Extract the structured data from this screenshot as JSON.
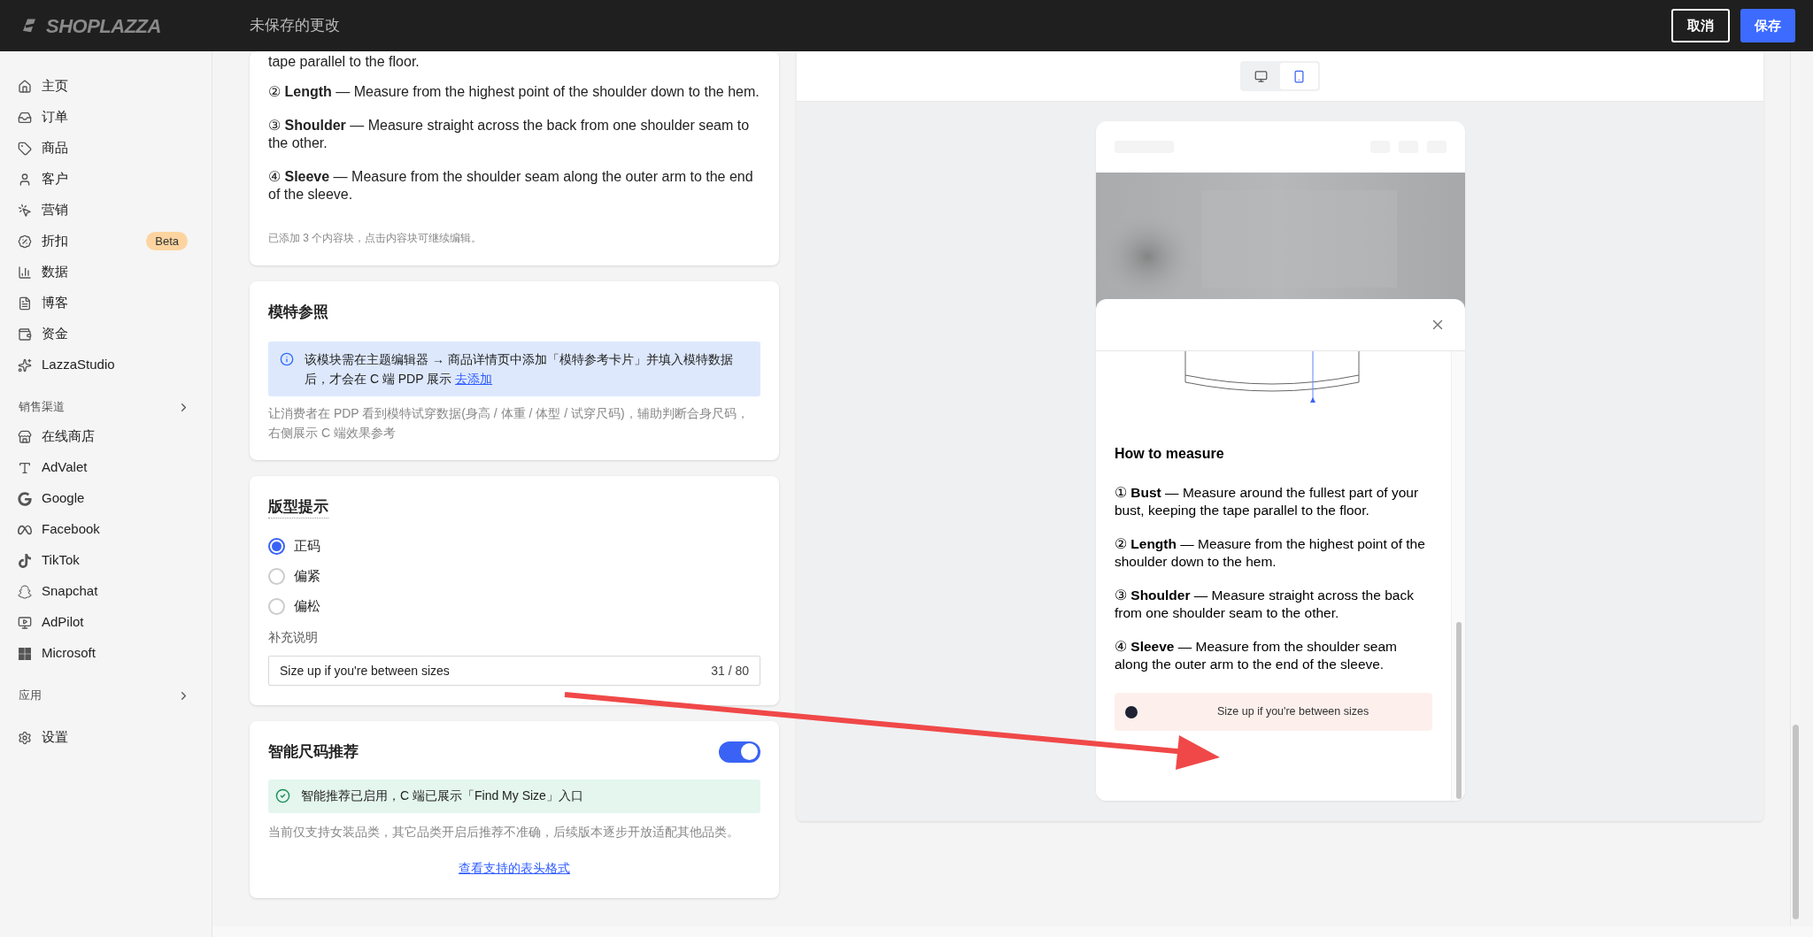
{
  "header": {
    "logo": "SHOPLAZZA",
    "title": "未保存的更改",
    "buttons": [
      {
        "label": "取消",
        "kind": "secondary"
      },
      {
        "label": "保存",
        "kind": "primary"
      }
    ]
  },
  "sidebar": {
    "groups": [
      {
        "items": [
          {
            "label": "主页"
          },
          {
            "label": "订单"
          },
          {
            "label": "商品"
          },
          {
            "label": "客户"
          },
          {
            "label": "营销"
          },
          {
            "label": "折扣",
            "badge": "Beta"
          },
          {
            "label": "数据"
          },
          {
            "label": "博客"
          },
          {
            "label": "资金"
          },
          {
            "label": "LazzaStudio"
          }
        ]
      },
      {
        "heading": "销售渠道",
        "items": [
          {
            "label": "在线商店"
          },
          {
            "label": "AdValet"
          },
          {
            "label": "Google"
          },
          {
            "label": "Facebook"
          },
          {
            "label": "TikTok"
          },
          {
            "label": "Snapchat"
          },
          {
            "label": "AdPilot"
          },
          {
            "label": "Microsoft"
          }
        ]
      },
      {
        "heading": "应用"
      },
      {
        "items": [
          {
            "label": "设置"
          }
        ]
      }
    ]
  },
  "editor": {
    "measure_card": {
      "partial_line": "tape parallel to the floor.",
      "steps": [
        "② **Length** — Measure from the highest point of the shoulder down to the hem.",
        "③ **Shoulder** — Measure straight across the back from one shoulder seam to the other.",
        "④ **Sleeve** — Measure from the shoulder seam along the outer arm to the end of the sleeve."
      ],
      "note": "已添加 3 个内容块，点击内容块可继续编辑。"
    },
    "model_card": {
      "title": "模特参照",
      "info": "该模块需在主题编辑器 → 商品详情页中添加「模特参考卡片」并填入模特数据后，才会在 C 端 PDP 展示",
      "info_link": "去添加",
      "description": "让消费者在 PDP 看到模特试穿数据(身高 / 体重 / 体型 / 试穿尺码)，辅助判断合身尺码，右侧展示 C 端效果参考"
    },
    "fit_card": {
      "title": "版型提示",
      "options": [
        {
          "label": "正码",
          "selected": true
        },
        {
          "label": "偏紧",
          "selected": false
        },
        {
          "label": "偏松",
          "selected": false
        }
      ],
      "field_label": "补充说明",
      "field_value": "Size up if you're between sizes",
      "counter": "31 / 80"
    },
    "smart_card": {
      "title": "智能尺码推荐",
      "on": true,
      "notice": "智能推荐已启用，C 端已展示「Find My Size」入口",
      "description": "当前仅支持女装品类，其它品类开启后推荐不准确，后续版本逐步开放适配其他品类。",
      "link": "查看支持的表头格式"
    }
  },
  "preview": {
    "devices": [
      {
        "kind": "desktop",
        "selected": false
      },
      {
        "kind": "mobile",
        "selected": true
      }
    ],
    "modal": {
      "heading": "How to measure",
      "steps": [
        "① **Bust** — Measure around the fullest part of your bust, keeping the tape parallel to the floor.",
        "② **Length** — Measure from the highest point of the shoulder down to the hem.",
        "③ **Shoulder** — Measure straight across the back from one shoulder seam to the other.",
        "④ **Sleeve** — Measure from the shoulder seam along the outer arm to the end of the sleeve."
      ],
      "fit_note": "Size up if you're between sizes"
    }
  }
}
